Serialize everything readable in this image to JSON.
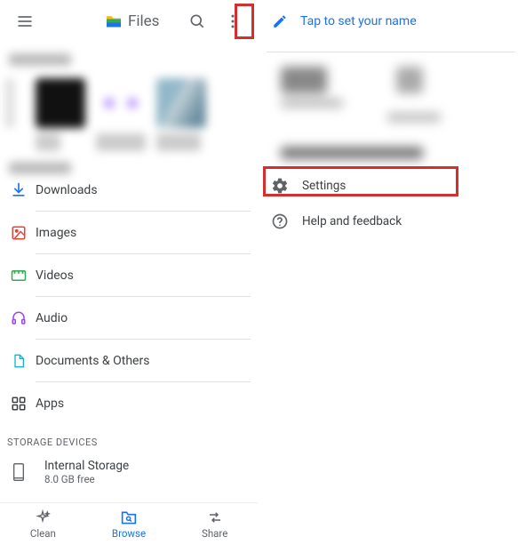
{
  "header": {
    "app_title": "Files"
  },
  "categories": [
    {
      "label": "Downloads"
    },
    {
      "label": "Images"
    },
    {
      "label": "Videos"
    },
    {
      "label": "Audio"
    },
    {
      "label": "Documents & Others"
    },
    {
      "label": "Apps"
    }
  ],
  "storage": {
    "section": "STORAGE DEVICES",
    "items": [
      {
        "name": "Internal Storage",
        "sub": "8.0 GB free"
      }
    ]
  },
  "bottom_nav": {
    "clean": "Clean",
    "browse": "Browse",
    "share": "Share"
  },
  "menu": {
    "set_name": "Tap to set your name",
    "settings": "Settings",
    "help": "Help and feedback"
  }
}
